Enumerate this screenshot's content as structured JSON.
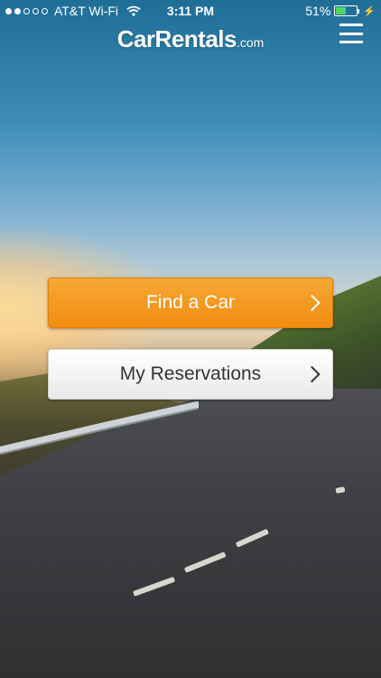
{
  "status_bar": {
    "carrier": "AT&T Wi-Fi",
    "signal_dots_filled": 2,
    "signal_dots_total": 5,
    "time": "3:11 PM",
    "battery_percent": "51%",
    "battery_level": 0.51,
    "battery_color": "#4cd964",
    "icons": [
      "wifi-icon",
      "battery-icon",
      "charging-bolt-icon"
    ]
  },
  "header": {
    "logo_main": "CarRentals",
    "logo_suffix": ".com",
    "menu_icon": "hamburger-menu-icon"
  },
  "actions": {
    "find_car_label": "Find a Car",
    "reservations_label": "My Reservations",
    "chevron_icon": "chevron-right-icon"
  },
  "colors": {
    "primary_button": "#f39a1e",
    "secondary_button": "#ffffff"
  }
}
